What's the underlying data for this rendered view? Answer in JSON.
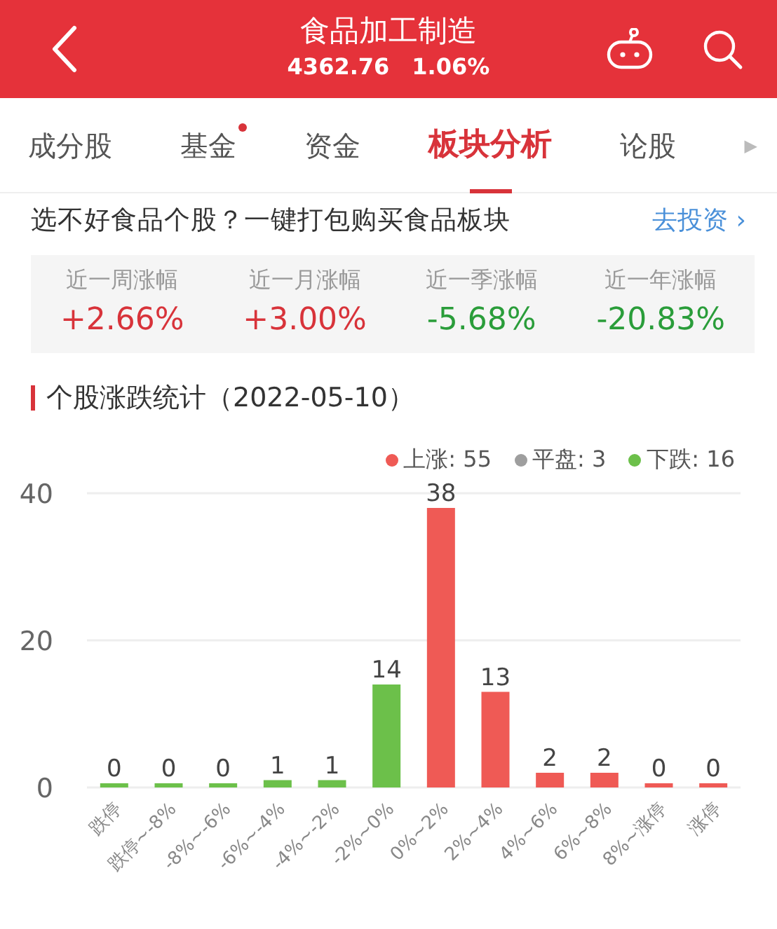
{
  "header": {
    "title": "食品加工制造",
    "price": "4362.76",
    "change": "1.06%"
  },
  "tabs": [
    {
      "label": "成分股",
      "selected": false,
      "dot": false
    },
    {
      "label": "基金",
      "selected": false,
      "dot": true
    },
    {
      "label": "资金",
      "selected": false,
      "dot": false
    },
    {
      "label": "板块分析",
      "selected": true,
      "dot": false
    },
    {
      "label": "论股",
      "selected": false,
      "dot": false
    }
  ],
  "tabs_more": "▶",
  "promo": {
    "text": "选不好食品个股？一键打包购买食品板块",
    "link": "去投资",
    "arrow": "›"
  },
  "stats": [
    {
      "label": "近一周涨幅",
      "value": "+2.66%",
      "kind": "up"
    },
    {
      "label": "近一月涨幅",
      "value": "+3.00%",
      "kind": "up"
    },
    {
      "label": "近一季涨幅",
      "value": "-5.68%",
      "kind": "down"
    },
    {
      "label": "近一年涨幅",
      "value": "-20.83%",
      "kind": "down"
    }
  ],
  "section_title": "个股涨跌统计（2022-05-10）",
  "legend": [
    {
      "label": "上涨: 55",
      "color": "#ef5a55"
    },
    {
      "label": "平盘: 3",
      "color": "#9e9e9e"
    },
    {
      "label": "下跌: 16",
      "color": "#6cc04a"
    }
  ],
  "chart_data": {
    "type": "bar",
    "data_labels": true,
    "categories": [
      "跌停",
      "跌停~-8%",
      "-8%~-6%",
      "-6%~-4%",
      "-4%~-2%",
      "-2%~0%",
      "0%~2%",
      "2%~4%",
      "4%~6%",
      "6%~8%",
      "8%~涨停",
      "涨停"
    ],
    "yticks": [
      0,
      20,
      40
    ],
    "ylim": [
      0,
      40
    ],
    "series": [
      {
        "color": "#6cc04a",
        "values": [
          0,
          0,
          0,
          1,
          1,
          14,
          null,
          null,
          null,
          null,
          null,
          null
        ]
      },
      {
        "color": "#ef5a55",
        "values": [
          null,
          null,
          null,
          null,
          null,
          null,
          38,
          13,
          2,
          2,
          0,
          0
        ]
      }
    ]
  }
}
